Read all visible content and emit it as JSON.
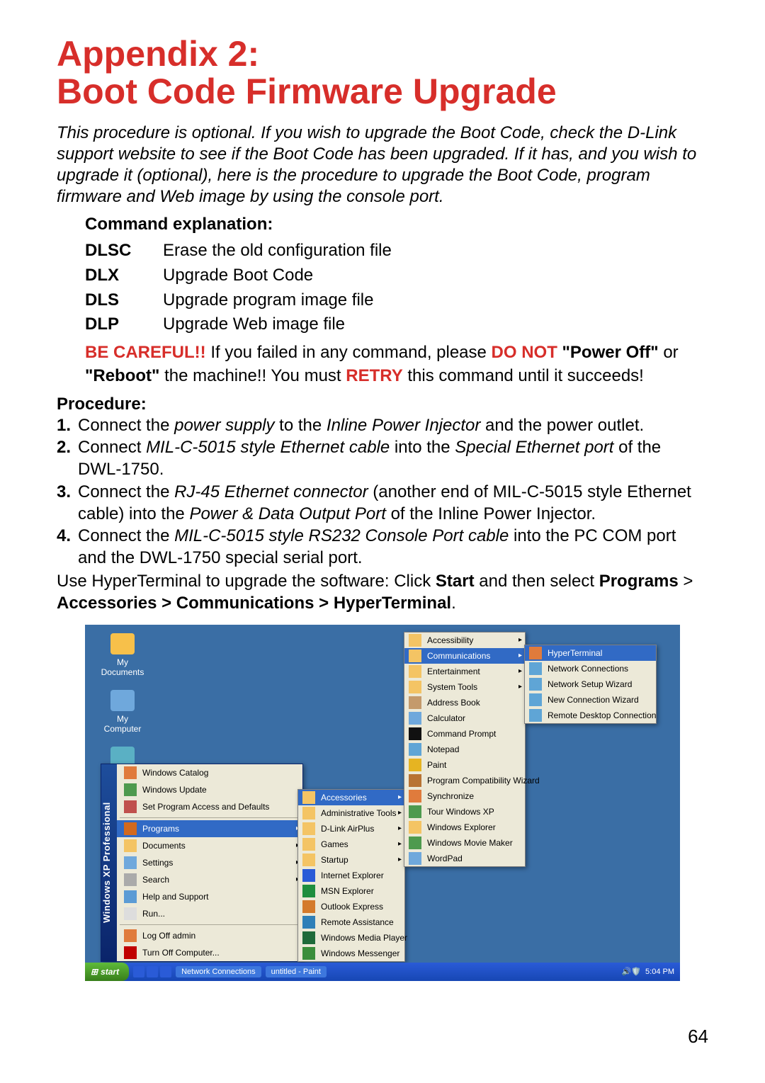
{
  "heading": "Appendix 2:\nBoot Code Firmware Upgrade",
  "intro": "This procedure is optional. If you wish to upgrade the Boot Code, check the D-Link support website to see if the Boot Code has been upgraded. If it has, and you wish to upgrade it (optional), here is the procedure to upgrade the Boot Code, program firmware and Web image by using the console port.",
  "command_heading": "Command explanation:",
  "commands": [
    {
      "code": "DLSC",
      "desc": "Erase the old configuration file"
    },
    {
      "code": "DLX",
      "desc": "Upgrade Boot Code"
    },
    {
      "code": "DLS",
      "desc": "Upgrade program image file"
    },
    {
      "code": "DLP",
      "desc": "Upgrade Web image file"
    }
  ],
  "warn": {
    "p1": "BE CAREFUL!!",
    "p2": " If you failed in any command, please ",
    "p3": "DO NOT",
    "p4": " \"Power Off\"",
    "p5": " or ",
    "p6": "\"Reboot\"",
    "p7": " the machine!! You must ",
    "p8": "RETRY",
    "p9": " this command until it succeeds!"
  },
  "proc_heading": "Procedure:",
  "procedure": [
    {
      "num": "1.",
      "pre": "Connect the ",
      "it1": "power supply",
      "mid1": " to the ",
      "it2": "Inline Power Injector",
      "post": " and the power outlet."
    },
    {
      "num": "2.",
      "pre": "Connect ",
      "it1": "MIL-C-5015 style Ethernet cable",
      "mid1": " into the ",
      "it2": "Special Ethernet port",
      "post": " of the DWL-1750."
    },
    {
      "num": "3.",
      "pre": "Connect the ",
      "it1": "RJ-45 Ethernet connector ",
      "mid1": "(another end of MIL-C-5015 style Ethernet cable) into the ",
      "it2": "Power & Data Output Port",
      "post": " of the Inline Power Injector."
    },
    {
      "num": "4.",
      "pre": "Connect the ",
      "it1": "MIL-C-5015 style RS232 Console Port cable",
      "mid1": " into the PC COM port and the DWL-1750 special serial port.",
      "it2": "",
      "post": ""
    }
  ],
  "hyper": {
    "p1": "Use HyperTerminal to upgrade the software: Click ",
    "p2": "Start",
    "p3": " and then select ",
    "p4": "Programs",
    "p5": " > ",
    "p6": "Accessories > Communications > HyperTerminal",
    "p7": "."
  },
  "screenshot": {
    "desktop": {
      "icon1": "My Documents",
      "icon2": "My Computer"
    },
    "stripe": "Windows XP Professional",
    "start_items_top": [
      "Windows Catalog",
      "Windows Update",
      "Set Program Access and Defaults"
    ],
    "start_programs": "Programs",
    "start_items_mid": [
      "Documents",
      "Settings",
      "Search",
      "Help and Support",
      "Run..."
    ],
    "start_items_bot": [
      "Log Off admin",
      "Turn Off Computer..."
    ],
    "programs_menu": [
      "Accessories",
      "Administrative Tools",
      "D-Link AirPlus",
      "Games",
      "Startup",
      "Internet Explorer",
      "MSN Explorer",
      "Outlook Express",
      "Remote Assistance",
      "Windows Media Player",
      "Windows Messenger"
    ],
    "accessories_menu": [
      "Accessibility",
      "Communications",
      "Entertainment",
      "System Tools",
      "Address Book",
      "Calculator",
      "Command Prompt",
      "Notepad",
      "Paint",
      "Program Compatibility Wizard",
      "Synchronize",
      "Tour Windows XP",
      "Windows Explorer",
      "Windows Movie Maker",
      "WordPad"
    ],
    "comm_menu": [
      "HyperTerminal",
      "Network Connections",
      "Network Setup Wizard",
      "New Connection Wizard",
      "Remote Desktop Connection"
    ],
    "taskbar": {
      "start": "start",
      "task1": "Network Connections",
      "task2": "untitled - Paint",
      "clock": "5:04 PM"
    }
  },
  "page_number": "64"
}
